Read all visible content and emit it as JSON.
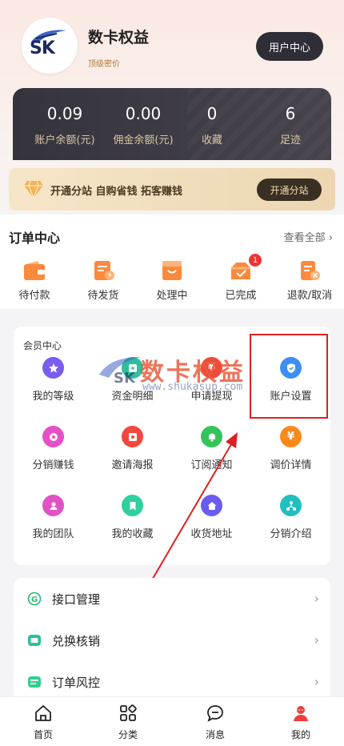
{
  "profile": {
    "name": "数卡权益",
    "subtitle": "顶级密价",
    "user_center_label": "用户中心"
  },
  "stats": [
    {
      "value": "0.09",
      "label": "账户余额(元)"
    },
    {
      "value": "0.00",
      "label": "佣金余额(元)"
    },
    {
      "value": "0",
      "label": "收藏"
    },
    {
      "value": "6",
      "label": "足迹"
    }
  ],
  "vip": {
    "text": "开通分站 自购省钱 拓客赚钱",
    "button_label": "开通分站"
  },
  "orders": {
    "title": "订单中心",
    "view_all": "查看全部",
    "items": [
      {
        "label": "待付款",
        "icon": "wallet-icon"
      },
      {
        "label": "待发货",
        "icon": "pending-ship-icon"
      },
      {
        "label": "处理中",
        "icon": "processing-icon"
      },
      {
        "label": "已完成",
        "icon": "completed-icon",
        "badge": "1"
      },
      {
        "label": "退款/取消",
        "icon": "refund-icon"
      }
    ]
  },
  "member": {
    "title": "会员中心",
    "items": [
      {
        "label": "我的等级",
        "icon": "star-icon",
        "color": "#7a5cf0"
      },
      {
        "label": "资金明细",
        "icon": "fund-icon",
        "color": "#2fbf9a"
      },
      {
        "label": "申请提现",
        "icon": "yuan-icon",
        "color": "#ef4b3b"
      },
      {
        "label": "账户设置",
        "icon": "shield-icon",
        "color": "#3d8ef5"
      },
      {
        "label": "分销赚钱",
        "icon": "distribution-icon",
        "color": "#e64fc7"
      },
      {
        "label": "邀请海报",
        "icon": "poster-icon",
        "color": "#f2473c"
      },
      {
        "label": "订阅通知",
        "icon": "bell-icon",
        "color": "#34c45a"
      },
      {
        "label": "调价详情",
        "icon": "price-icon",
        "color": "#fb8a1c"
      },
      {
        "label": "我的团队",
        "icon": "team-icon",
        "color": "#e052c3"
      },
      {
        "label": "我的收藏",
        "icon": "bookmark-icon",
        "color": "#30cf9e"
      },
      {
        "label": "收货地址",
        "icon": "home-icon",
        "color": "#6a5cf2"
      },
      {
        "label": "分销介绍",
        "icon": "network-icon",
        "color": "#1fbfbf"
      }
    ]
  },
  "watermark": {
    "text": "数卡权益",
    "url": "www.shukasup.com"
  },
  "list": [
    {
      "label": "接口管理",
      "icon": "api-icon",
      "color": "#2bb673"
    },
    {
      "label": "兑换核销",
      "icon": "redeem-icon",
      "color": "#2bbf9a"
    },
    {
      "label": "订单风控",
      "icon": "risk-icon",
      "color": "#2fcf8f"
    }
  ],
  "tabbar": [
    {
      "label": "首页",
      "icon": "home-tab-icon"
    },
    {
      "label": "分类",
      "icon": "category-icon"
    },
    {
      "label": "消息",
      "icon": "message-icon"
    },
    {
      "label": "我的",
      "icon": "profile-icon",
      "active_color": "#ef3e3e"
    }
  ]
}
